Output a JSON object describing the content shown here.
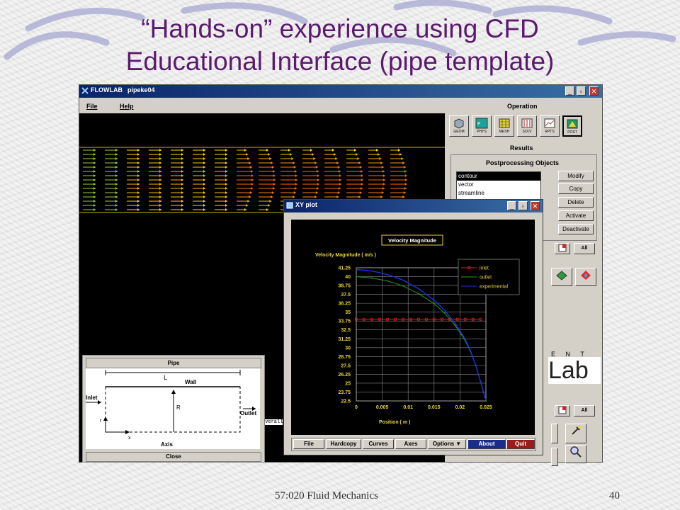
{
  "slide": {
    "title_line1": "“Hands-on” experience using CFD",
    "title_line2": "Educational Interface (pipe template)",
    "footer_left": "57:020 Fluid Mechanics",
    "footer_right": "40",
    "colors": {
      "title": "#5b1a6e"
    }
  },
  "app": {
    "title": "FLOWLAB",
    "file": "pipeke04",
    "menu": [
      "File",
      "Help"
    ],
    "overall_text": "overall"
  },
  "operation": {
    "label": "Operation",
    "buttons": [
      "GEOM",
      "PHYS",
      "MESH",
      "SOLV",
      "RPTS",
      "POST"
    ]
  },
  "results": {
    "label": "Results",
    "postprocessing_label": "Postprocessing Objects",
    "objects": [
      "contour",
      "vector",
      "streamline"
    ],
    "selected": "contour",
    "buttons": [
      "Modify",
      "Copy",
      "Delete",
      "Activate",
      "Deactivate"
    ],
    "all_label": "All",
    "all_label2": "All",
    "logo_letters": "E N T",
    "logo_text": "Lab"
  },
  "pipe_window": {
    "title": "Pipe",
    "close": "Close",
    "labels": {
      "L": "L",
      "wall": "Wall",
      "inlet": "Inlet",
      "outlet": "Outlet",
      "R": "R",
      "axis": "Axis",
      "x": "x",
      "r": "r"
    }
  },
  "xy_window": {
    "title": "XY plot",
    "buttons": [
      "File",
      "Hardcopy",
      "Curves",
      "Axes",
      "Options ▼",
      "About",
      "Quit"
    ]
  },
  "chart_data": {
    "type": "line",
    "title": "Velocity Magnitude",
    "ylabel": "Velocity Magnitude ( m/s )",
    "xlabel": "Position ( m )",
    "xlim": [
      0,
      0.025
    ],
    "ylim": [
      22.5,
      41.25
    ],
    "x_ticks": [
      "0",
      "0.005",
      "0.01",
      "0.015",
      "0.02",
      "0.025"
    ],
    "y_ticks": [
      "41.25",
      "40",
      "38.75",
      "37.5",
      "36.25",
      "35",
      "33.75",
      "32.5",
      "31.25",
      "30",
      "28.75",
      "27.5",
      "26.25",
      "25",
      "23.75",
      "22.5"
    ],
    "grid": true,
    "legend_position": "top-right",
    "series": [
      {
        "name": "inlet",
        "color": "#e02020",
        "x": [
          0,
          0.0015,
          0.003,
          0.0045,
          0.006,
          0.0075,
          0.009,
          0.0105,
          0.012,
          0.0135,
          0.015,
          0.0165,
          0.018,
          0.0195,
          0.021,
          0.0225,
          0.024
        ],
        "y": [
          34,
          34,
          34,
          34,
          34,
          34,
          34,
          34,
          34,
          34,
          34,
          34,
          34,
          34,
          34,
          34,
          34
        ]
      },
      {
        "name": "outlet",
        "color": "#20a020",
        "x": [
          0,
          0.003,
          0.006,
          0.009,
          0.012,
          0.015,
          0.017,
          0.019,
          0.021,
          0.022,
          0.023,
          0.024,
          0.0245,
          0.025
        ],
        "y": [
          40,
          39.8,
          39.4,
          38.7,
          37.6,
          36.2,
          34.9,
          33.2,
          31.0,
          29.5,
          27.6,
          25.2,
          23.8,
          22.5
        ]
      },
      {
        "name": "experimental",
        "color": "#2030e0",
        "x": [
          0,
          0.003,
          0.006,
          0.009,
          0.012,
          0.015,
          0.017,
          0.019,
          0.021,
          0.022,
          0.023,
          0.024,
          0.0245,
          0.025
        ],
        "y": [
          41,
          40.8,
          40.3,
          39.5,
          38.3,
          36.7,
          35.3,
          33.5,
          31.2,
          29.6,
          27.6,
          25.1,
          23.8,
          22.6
        ]
      }
    ]
  }
}
